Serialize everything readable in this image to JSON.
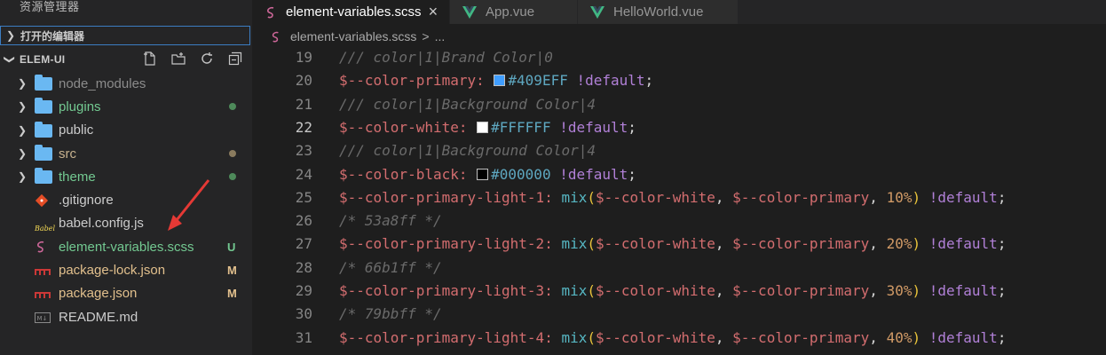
{
  "sidebar": {
    "title": "资源管理器",
    "open_editors": "打开的编辑器",
    "project": "ELEM-UI",
    "tree": [
      {
        "name": "node_modules",
        "type": "folder",
        "color": "#8c8c8c",
        "status": ""
      },
      {
        "name": "plugins",
        "type": "folder",
        "color": "#73c991",
        "status": "dot",
        "status_color": "#4e8a5a"
      },
      {
        "name": "public",
        "type": "folder",
        "color": "#cccccc",
        "status": ""
      },
      {
        "name": "src",
        "type": "folder",
        "color": "#c7b28f",
        "status": "dot",
        "status_color": "#8a7b5e"
      },
      {
        "name": "theme",
        "type": "folder",
        "color": "#73c991",
        "status": "dot",
        "status_color": "#4e8a5a"
      },
      {
        "name": ".gitignore",
        "type": "git",
        "color": "#cccccc",
        "status": ""
      },
      {
        "name": "babel.config.js",
        "type": "babel",
        "color": "#cccccc",
        "status": ""
      },
      {
        "name": "element-variables.scss",
        "type": "sass",
        "color": "#73c991",
        "status": "U",
        "status_color": "#73c991"
      },
      {
        "name": "package-lock.json",
        "type": "npm",
        "color": "#e2c08d",
        "status": "M",
        "status_color": "#e2c08d"
      },
      {
        "name": "package.json",
        "type": "npm",
        "color": "#e2c08d",
        "status": "M",
        "status_color": "#e2c08d"
      },
      {
        "name": "README.md",
        "type": "md",
        "color": "#cccccc",
        "status": ""
      }
    ]
  },
  "tabs": [
    {
      "label": "element-variables.scss",
      "active": true,
      "icon": "sass-icon",
      "close": "×"
    },
    {
      "label": "App.vue",
      "active": false,
      "icon": "vue-icon"
    },
    {
      "label": "HelloWorld.vue",
      "active": false,
      "icon": "vue-icon"
    }
  ],
  "breadcrumb": {
    "file": "element-variables.scss",
    "sep": ">",
    "more": "..."
  },
  "editor": {
    "current_line": 22,
    "lines": [
      {
        "n": 19
      },
      {
        "n": 20
      },
      {
        "n": 21
      },
      {
        "n": 22
      },
      {
        "n": 23
      },
      {
        "n": 24
      },
      {
        "n": 25
      },
      {
        "n": 26
      },
      {
        "n": 27
      },
      {
        "n": 28
      },
      {
        "n": 29
      },
      {
        "n": 30
      },
      {
        "n": 31
      }
    ],
    "text": {
      "l19": "/// color|1|Brand Color|0",
      "l20_var": "$--color-primary:",
      "l20_hex": "#409EFF",
      "l20_kw": "!default",
      "semi": ";",
      "l21": "/// color|1|Background Color|4",
      "l22_var": "$--color-white:",
      "l22_hex": "#FFFFFF",
      "l23": "/// color|1|Background Color|4",
      "l24_var": "$--color-black:",
      "l24_hex": "#000000",
      "l25_var": "$--color-primary-light-1:",
      "mix": "mix",
      "arg1": "$--color-white",
      "comma": ",",
      "arg2": "$--color-primary",
      "p10": "10%",
      "p20": "20%",
      "p30": "30%",
      "p40": "40%",
      "l26": "/* 53a8ff */",
      "l27_var": "$--color-primary-light-2:",
      "l28": "/* 66b1ff */",
      "l29_var": "$--color-primary-light-3:",
      "l30": "/* 79bbff */",
      "l31_var": "$--color-primary-light-4:"
    },
    "swatches": {
      "primary": "#409EFF",
      "white": "#FFFFFF",
      "black": "#000000"
    }
  }
}
